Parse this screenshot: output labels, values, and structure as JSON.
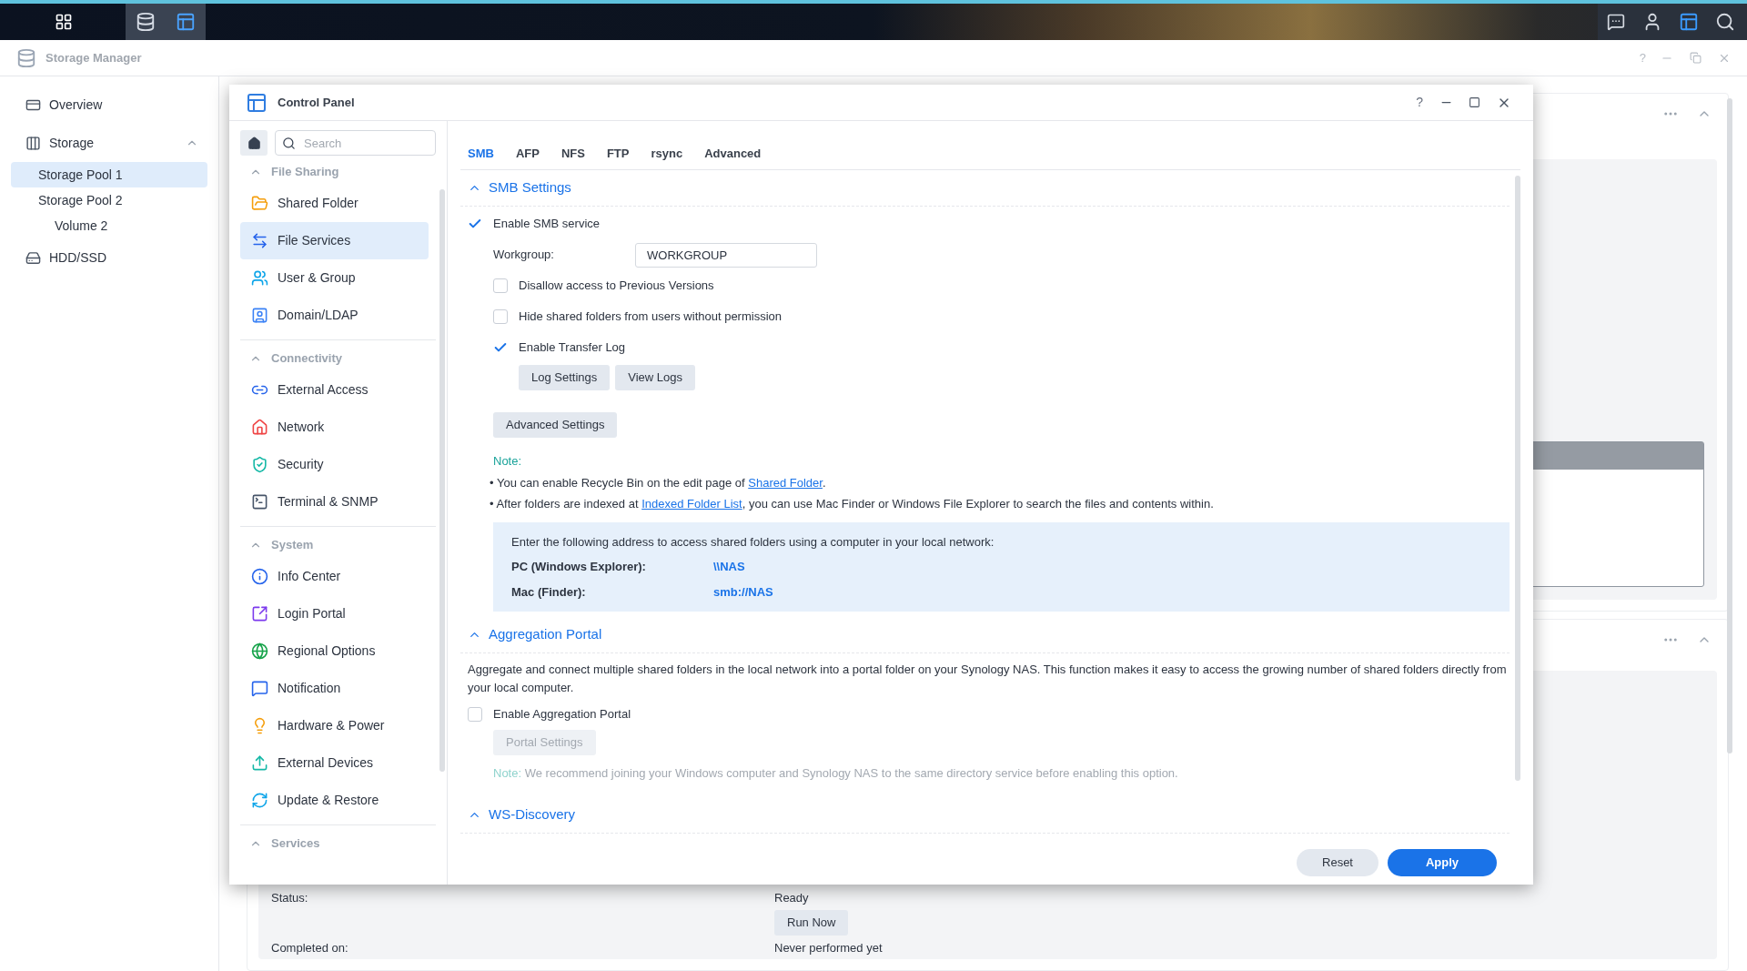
{
  "taskbar": {
    "apps": [
      {
        "open": false
      },
      {
        "open": true
      },
      {
        "open": true
      }
    ]
  },
  "storage_manager": {
    "title": "Storage Manager",
    "help": "?",
    "sidebar": [
      {
        "label": "Overview",
        "selected": false
      },
      {
        "label": "Storage",
        "selected": false,
        "expanded": true,
        "children": [
          {
            "label": "Storage Pool 1",
            "selected": true
          },
          {
            "label": "Storage Pool 2",
            "selected": false,
            "children": [
              {
                "label": "Volume 2",
                "selected": false
              }
            ]
          }
        ]
      },
      {
        "label": "HDD/SSD",
        "selected": false
      }
    ],
    "task": {
      "status_label": "Status:",
      "status": "Ready",
      "button": "Run Now",
      "completed_label": "Completed on:",
      "completed": "Never performed yet"
    }
  },
  "control_panel": {
    "title": "Control Panel",
    "help": "?",
    "search": {
      "placeholder": "Search"
    },
    "nav": [
      {
        "title": "File Sharing",
        "expanded": true,
        "items": [
          {
            "label": "Shared Folder",
            "selected": false
          },
          {
            "label": "File Services",
            "selected": true
          },
          {
            "label": "User & Group",
            "selected": false
          },
          {
            "label": "Domain/LDAP",
            "selected": false
          }
        ]
      },
      {
        "title": "Connectivity",
        "expanded": true,
        "items": [
          {
            "label": "External Access",
            "selected": false
          },
          {
            "label": "Network",
            "selected": false
          },
          {
            "label": "Security",
            "selected": false
          },
          {
            "label": "Terminal & SNMP",
            "selected": false
          }
        ]
      },
      {
        "title": "System",
        "expanded": true,
        "items": [
          {
            "label": "Info Center",
            "selected": false
          },
          {
            "label": "Login Portal",
            "selected": false
          },
          {
            "label": "Regional Options",
            "selected": false
          },
          {
            "label": "Notification",
            "selected": false
          },
          {
            "label": "Hardware & Power",
            "selected": false
          },
          {
            "label": "External Devices",
            "selected": false
          },
          {
            "label": "Update & Restore",
            "selected": false
          }
        ]
      },
      {
        "title": "Services",
        "expanded": true
      }
    ],
    "tabs": [
      {
        "label": "SMB",
        "selected": true
      },
      {
        "label": "AFP",
        "selected": false
      },
      {
        "label": "NFS",
        "selected": false
      },
      {
        "label": "FTP",
        "selected": false
      },
      {
        "label": "rsync",
        "selected": false
      },
      {
        "label": "Advanced",
        "selected": false
      }
    ],
    "smb": {
      "title": "SMB Settings",
      "expanded": true,
      "enable": {
        "label": "Enable SMB service",
        "checked": true
      },
      "workgroup": {
        "label": "Workgroup:",
        "value": "WORKGROUP"
      },
      "options": [
        {
          "label": "Disallow access to Previous Versions",
          "checked": false
        },
        {
          "label": "Hide shared folders from users without permission",
          "checked": false
        },
        {
          "label": "Enable Transfer Log",
          "checked": true
        }
      ],
      "log_buttons": [
        "Log Settings",
        "View Logs"
      ],
      "advanced_button": "Advanced Settings",
      "note": {
        "label": "Note:",
        "items": [
          {
            "before": "• You can enable Recycle Bin on the edit page of ",
            "link": "Shared Folder",
            "after": "."
          },
          {
            "before": "• After folders are indexed at ",
            "link": "Indexed Folder List",
            "after": ", you can use Mac Finder or Windows File Explorer to search the files and contents within."
          }
        ]
      },
      "address": {
        "intro": "Enter the following address to access shared folders using a computer in your local network:",
        "rows": [
          {
            "label": "PC (Windows Explorer):",
            "value": "\\\\NAS"
          },
          {
            "label": "Mac (Finder):",
            "value": "smb://NAS"
          }
        ]
      }
    },
    "aggregation": {
      "title": "Aggregation Portal",
      "expanded": true,
      "description": "Aggregate and connect multiple shared folders in the local network into a portal folder on your Synology NAS. This function makes it easy to access the growing number of shared folders directly from your local computer.",
      "enable": {
        "label": "Enable Aggregation Portal",
        "checked": false
      },
      "button": {
        "label": "Portal Settings",
        "disabled": true
      },
      "note": {
        "label": "Note:",
        "text": "We recommend joining your Windows computer and Synology NAS to the same directory service before enabling this option.",
        "disabled": true
      }
    },
    "ws_discovery": {
      "title": "WS-Discovery",
      "expanded": true
    },
    "footer": [
      {
        "label": "Reset",
        "kind": "secondary"
      },
      {
        "label": "Apply",
        "kind": "primary"
      }
    ]
  }
}
